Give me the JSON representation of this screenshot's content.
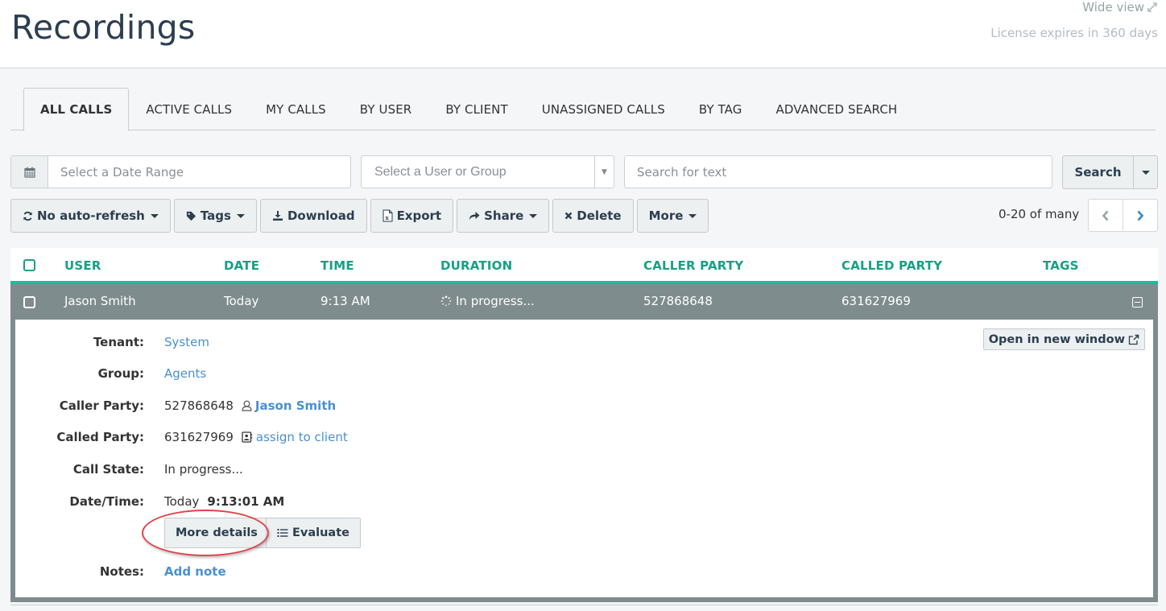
{
  "header": {
    "title": "Recordings",
    "wide_view": "Wide view",
    "license": "License expires in 360 days"
  },
  "tabs": [
    {
      "label": "ALL CALLS",
      "active": true
    },
    {
      "label": "ACTIVE CALLS",
      "active": false
    },
    {
      "label": "MY CALLS",
      "active": false
    },
    {
      "label": "BY USER",
      "active": false
    },
    {
      "label": "BY CLIENT",
      "active": false
    },
    {
      "label": "UNASSIGNED CALLS",
      "active": false
    },
    {
      "label": "BY TAG",
      "active": false
    },
    {
      "label": "ADVANCED SEARCH",
      "active": false
    }
  ],
  "filters": {
    "date_placeholder": "Select a Date Range",
    "date_value": "",
    "user_placeholder": "Select a User or Group",
    "text_placeholder": "Search for text",
    "text_value": "",
    "search_label": "Search"
  },
  "toolbar": {
    "refresh": "No auto-refresh",
    "tags": "Tags",
    "download": "Download",
    "export": "Export",
    "share": "Share",
    "delete": "Delete",
    "more": "More"
  },
  "pager": {
    "range": "0-20 of many"
  },
  "table": {
    "columns": [
      "USER",
      "DATE",
      "TIME",
      "DURATION",
      "CALLER PARTY",
      "CALLED PARTY",
      "TAGS"
    ],
    "rows": [
      {
        "user": "Jason Smith",
        "date": "Today",
        "time": "9:13 AM",
        "duration": "In progress...",
        "caller_party": "527868648",
        "called_party": "631627969",
        "tags": ""
      }
    ]
  },
  "details": {
    "open_new_window": "Open in new window",
    "tenant_label": "Tenant:",
    "tenant": "System",
    "group_label": "Group:",
    "group": "Agents",
    "caller_label": "Caller Party:",
    "caller_number": "527868648",
    "caller_name": "Jason Smith",
    "called_label": "Called Party:",
    "called_number": "631627969",
    "assign_client": "assign to client",
    "state_label": "Call State:",
    "state": "In progress...",
    "datetime_label": "Date/Time:",
    "date": "Today",
    "time": "9:13:01 AM",
    "more_details": "More details",
    "evaluate": "Evaluate",
    "notes_label": "Notes:",
    "add_note": "Add note"
  },
  "colors": {
    "accent": "#1abc9c",
    "header_text": "#16a085",
    "row_selected": "#7f8c8d",
    "link": "#4a90d0",
    "title": "#2c3e50",
    "highlight": "#e0434b"
  }
}
